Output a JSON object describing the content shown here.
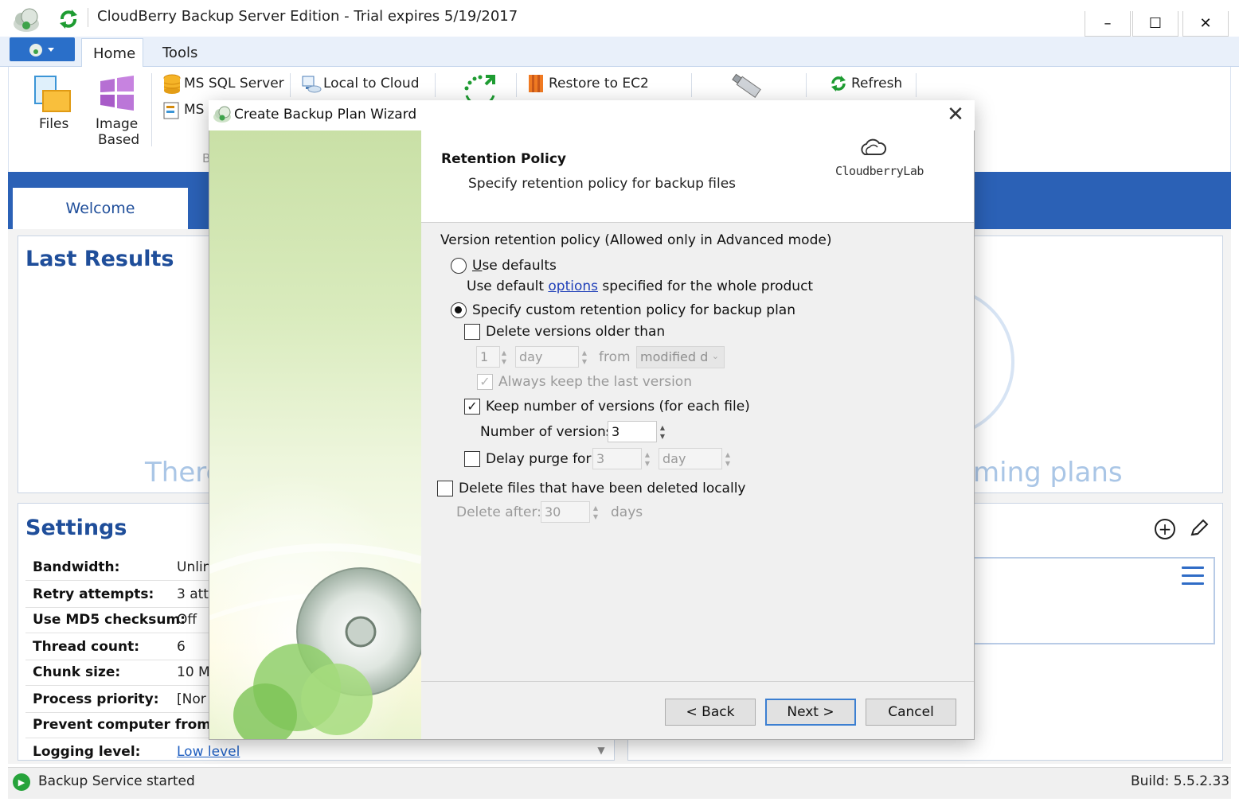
{
  "app": {
    "title": "CloudBerry Backup Server Edition - Trial expires 5/19/2017",
    "window_controls": {
      "minimize": "–",
      "maximize": "☐",
      "close": "✕"
    }
  },
  "ribbon": {
    "tabs": [
      "Home",
      "Tools"
    ],
    "buttons": {
      "files": "Files",
      "image_based_1": "Image",
      "image_based_2": "Based",
      "ms_sql_server": "MS SQL Server",
      "ms_partial": "MS",
      "local_to_cloud": "Local to Cloud",
      "restore_to_ec2": "Restore to EC2",
      "refresh": "Refresh",
      "group_partial": "B"
    }
  },
  "welcome_tab": "Welcome",
  "last_results": {
    "title": "Last Results",
    "empty_left": "There",
    "empty_right": "ming plans"
  },
  "settings": {
    "title": "Settings",
    "rows": [
      {
        "label": "Bandwidth:",
        "value": "Unlin"
      },
      {
        "label": "Retry attempts:",
        "value": "3  att"
      },
      {
        "label": "Use MD5 checksum:",
        "value": "Off"
      },
      {
        "label": "Thread count:",
        "value": "6"
      },
      {
        "label": "Chunk size:",
        "value": "10 M"
      },
      {
        "label": "Process priority:",
        "value": "[Nor"
      },
      {
        "label": "Prevent computer from sl",
        "value": ""
      },
      {
        "label": "Logging level:",
        "value": "Low level"
      }
    ]
  },
  "status": {
    "text": "Backup Service started",
    "build": "Build: 5.5.2.33"
  },
  "wizard": {
    "title": "Create Backup Plan Wizard",
    "close": "✕",
    "header_title": "Retention Policy",
    "header_subtitle": "Specify retention policy for backup files",
    "logo_text": "CloudberryLab",
    "version_policy_label": "Version retention policy (Allowed only in Advanced mode)",
    "use_defaults": "Use defaults",
    "use_default_prefix": "Use default ",
    "use_default_link": "options",
    "use_default_suffix": " specified for the whole product",
    "custom_policy": "Specify custom retention policy for backup plan",
    "delete_older": "Delete versions older than",
    "older_value": "1",
    "older_unit": "day",
    "from_label": "from",
    "from_value": "modified d",
    "always_keep": "Always keep the last version",
    "keep_number": "Keep number of versions (for each file)",
    "number_label": "Number of versions:",
    "number_value": "3",
    "delay_purge": "Delay purge for:",
    "delay_value": "3",
    "delay_unit": "day",
    "delete_local": "Delete files that have been deleted locally",
    "delete_after_label": "Delete after:",
    "delete_after_value": "30",
    "delete_after_unit": "days",
    "buttons": {
      "back": "< Back",
      "next": "Next >",
      "cancel": "Cancel"
    },
    "state": {
      "use_defaults_selected": false,
      "custom_selected": true,
      "delete_older_checked": false,
      "always_keep_checked": true,
      "keep_number_checked": true,
      "delay_purge_checked": false,
      "delete_local_checked": false
    }
  },
  "colors": {
    "accent_blue": "#2b61b6",
    "title_blue": "#1f4e9a",
    "link_blue": "#1f5fc1",
    "status_green": "#27a33b"
  }
}
